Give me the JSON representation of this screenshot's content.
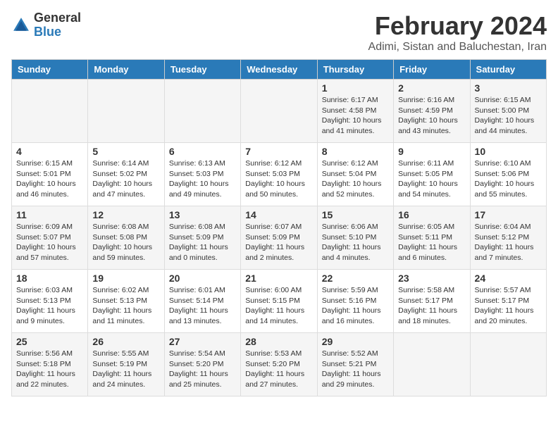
{
  "logo": {
    "text_general": "General",
    "text_blue": "Blue"
  },
  "header": {
    "month": "February 2024",
    "location": "Adimi, Sistan and Baluchestan, Iran"
  },
  "weekdays": [
    "Sunday",
    "Monday",
    "Tuesday",
    "Wednesday",
    "Thursday",
    "Friday",
    "Saturday"
  ],
  "weeks": [
    [
      {
        "day": "",
        "detail": ""
      },
      {
        "day": "",
        "detail": ""
      },
      {
        "day": "",
        "detail": ""
      },
      {
        "day": "",
        "detail": ""
      },
      {
        "day": "1",
        "detail": "Sunrise: 6:17 AM\nSunset: 4:58 PM\nDaylight: 10 hours\nand 41 minutes."
      },
      {
        "day": "2",
        "detail": "Sunrise: 6:16 AM\nSunset: 4:59 PM\nDaylight: 10 hours\nand 43 minutes."
      },
      {
        "day": "3",
        "detail": "Sunrise: 6:15 AM\nSunset: 5:00 PM\nDaylight: 10 hours\nand 44 minutes."
      }
    ],
    [
      {
        "day": "4",
        "detail": "Sunrise: 6:15 AM\nSunset: 5:01 PM\nDaylight: 10 hours\nand 46 minutes."
      },
      {
        "day": "5",
        "detail": "Sunrise: 6:14 AM\nSunset: 5:02 PM\nDaylight: 10 hours\nand 47 minutes."
      },
      {
        "day": "6",
        "detail": "Sunrise: 6:13 AM\nSunset: 5:03 PM\nDaylight: 10 hours\nand 49 minutes."
      },
      {
        "day": "7",
        "detail": "Sunrise: 6:12 AM\nSunset: 5:03 PM\nDaylight: 10 hours\nand 50 minutes."
      },
      {
        "day": "8",
        "detail": "Sunrise: 6:12 AM\nSunset: 5:04 PM\nDaylight: 10 hours\nand 52 minutes."
      },
      {
        "day": "9",
        "detail": "Sunrise: 6:11 AM\nSunset: 5:05 PM\nDaylight: 10 hours\nand 54 minutes."
      },
      {
        "day": "10",
        "detail": "Sunrise: 6:10 AM\nSunset: 5:06 PM\nDaylight: 10 hours\nand 55 minutes."
      }
    ],
    [
      {
        "day": "11",
        "detail": "Sunrise: 6:09 AM\nSunset: 5:07 PM\nDaylight: 10 hours\nand 57 minutes."
      },
      {
        "day": "12",
        "detail": "Sunrise: 6:08 AM\nSunset: 5:08 PM\nDaylight: 10 hours\nand 59 minutes."
      },
      {
        "day": "13",
        "detail": "Sunrise: 6:08 AM\nSunset: 5:09 PM\nDaylight: 11 hours\nand 0 minutes."
      },
      {
        "day": "14",
        "detail": "Sunrise: 6:07 AM\nSunset: 5:09 PM\nDaylight: 11 hours\nand 2 minutes."
      },
      {
        "day": "15",
        "detail": "Sunrise: 6:06 AM\nSunset: 5:10 PM\nDaylight: 11 hours\nand 4 minutes."
      },
      {
        "day": "16",
        "detail": "Sunrise: 6:05 AM\nSunset: 5:11 PM\nDaylight: 11 hours\nand 6 minutes."
      },
      {
        "day": "17",
        "detail": "Sunrise: 6:04 AM\nSunset: 5:12 PM\nDaylight: 11 hours\nand 7 minutes."
      }
    ],
    [
      {
        "day": "18",
        "detail": "Sunrise: 6:03 AM\nSunset: 5:13 PM\nDaylight: 11 hours\nand 9 minutes."
      },
      {
        "day": "19",
        "detail": "Sunrise: 6:02 AM\nSunset: 5:13 PM\nDaylight: 11 hours\nand 11 minutes."
      },
      {
        "day": "20",
        "detail": "Sunrise: 6:01 AM\nSunset: 5:14 PM\nDaylight: 11 hours\nand 13 minutes."
      },
      {
        "day": "21",
        "detail": "Sunrise: 6:00 AM\nSunset: 5:15 PM\nDaylight: 11 hours\nand 14 minutes."
      },
      {
        "day": "22",
        "detail": "Sunrise: 5:59 AM\nSunset: 5:16 PM\nDaylight: 11 hours\nand 16 minutes."
      },
      {
        "day": "23",
        "detail": "Sunrise: 5:58 AM\nSunset: 5:17 PM\nDaylight: 11 hours\nand 18 minutes."
      },
      {
        "day": "24",
        "detail": "Sunrise: 5:57 AM\nSunset: 5:17 PM\nDaylight: 11 hours\nand 20 minutes."
      }
    ],
    [
      {
        "day": "25",
        "detail": "Sunrise: 5:56 AM\nSunset: 5:18 PM\nDaylight: 11 hours\nand 22 minutes."
      },
      {
        "day": "26",
        "detail": "Sunrise: 5:55 AM\nSunset: 5:19 PM\nDaylight: 11 hours\nand 24 minutes."
      },
      {
        "day": "27",
        "detail": "Sunrise: 5:54 AM\nSunset: 5:20 PM\nDaylight: 11 hours\nand 25 minutes."
      },
      {
        "day": "28",
        "detail": "Sunrise: 5:53 AM\nSunset: 5:20 PM\nDaylight: 11 hours\nand 27 minutes."
      },
      {
        "day": "29",
        "detail": "Sunrise: 5:52 AM\nSunset: 5:21 PM\nDaylight: 11 hours\nand 29 minutes."
      },
      {
        "day": "",
        "detail": ""
      },
      {
        "day": "",
        "detail": ""
      }
    ]
  ]
}
